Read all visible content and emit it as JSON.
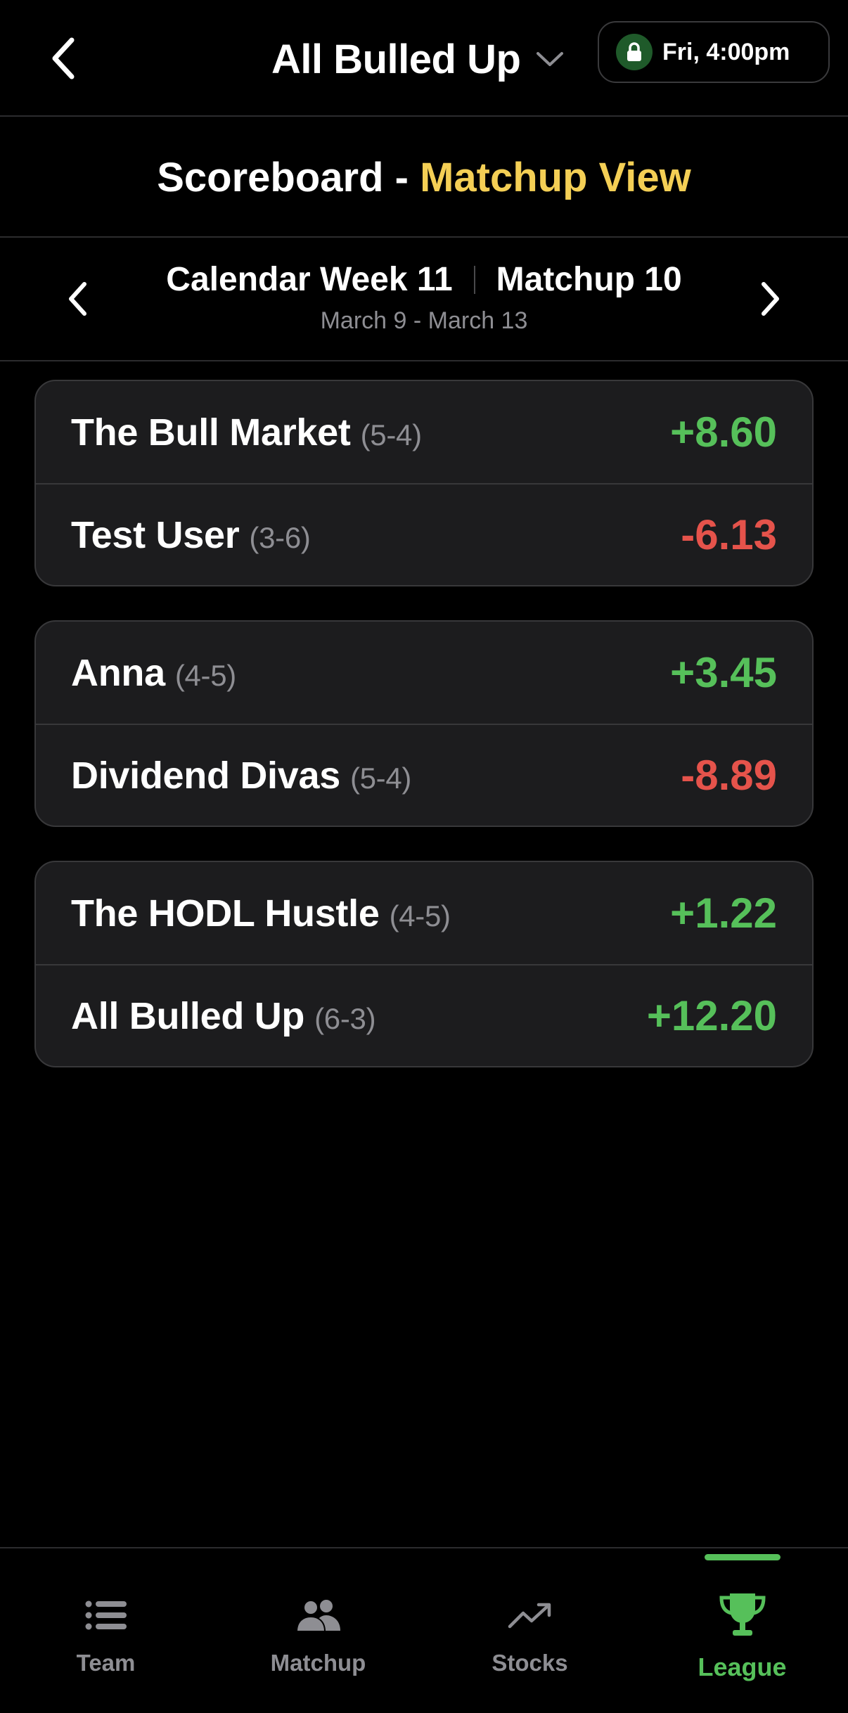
{
  "header": {
    "league_name": "All Bulled Up",
    "lock_time": "Fri, 4:00pm"
  },
  "scoreboard": {
    "title_prefix": "Scoreboard -",
    "title_accent": "Matchup View"
  },
  "week_nav": {
    "week_label": "Calendar Week 11",
    "matchup_label": "Matchup 10",
    "date_range": "March 9 - March 13"
  },
  "matchups": [
    {
      "home": {
        "name": "The Bull Market",
        "record": "(5-4)",
        "score": "+8.60"
      },
      "away": {
        "name": "Test User",
        "record": "(3-6)",
        "score": "-6.13"
      }
    },
    {
      "home": {
        "name": "Anna",
        "record": "(4-5)",
        "score": "+3.45"
      },
      "away": {
        "name": "Dividend Divas",
        "record": "(5-4)",
        "score": "-8.89"
      }
    },
    {
      "home": {
        "name": "The HODL Hustle",
        "record": "(4-5)",
        "score": "+1.22"
      },
      "away": {
        "name": "All Bulled Up",
        "record": "(6-3)",
        "score": "+12.20"
      }
    }
  ],
  "tabs": [
    {
      "label": "Team",
      "icon": "list-icon"
    },
    {
      "label": "Matchup",
      "icon": "people-icon"
    },
    {
      "label": "Stocks",
      "icon": "trend-icon"
    },
    {
      "label": "League",
      "icon": "trophy-icon"
    }
  ],
  "active_tab": "League",
  "colors": {
    "accent_yellow": "#f4cf55",
    "positive": "#56c05a",
    "negative": "#e5534b",
    "card_bg": "#1c1c1e"
  }
}
